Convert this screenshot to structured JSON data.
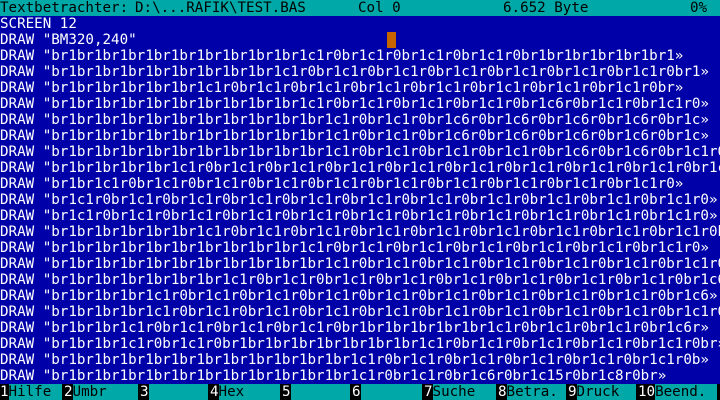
{
  "status": {
    "app_title": "Textbetrachter:",
    "file_path": "D:\\...RAFIK\\TEST.BAS",
    "column": "Col 0",
    "size": "6.652 Byte",
    "percent": "0%"
  },
  "lines": [
    "SCREEN 12",
    "DRAW \"BM320,240\"",
    "DRAW \"br1br1br1br1br1br1br1br1br1br1c1r0br1c1r0br1c1r0br1c1r0br1br1br1br1br1br1»",
    "DRAW \"br1br1br1br1br1br1br1br1br1c1r0br1c1r0br1c1r0br1c1r0br1c1r0br1c1r0br1c1r0br1»",
    "DRAW \"br1br1br1br1br1br1c1r0br1c1r0br1c1r0br1c1r0br1c1r0br1c1r0br1c1r0br1c1r0br»",
    "DRAW \"br1br1br1br1br1br1br1br1br1br1c1r0br1c1r0br1c1r0br1c1r0br1c6r0br1c1r0br1c1r0»",
    "DRAW \"br1br1br1br1br1br1br1br1br1br1br1c1r0br1c1r0br1c6r0br1c6r0br1c6r0br1c6r0br1c»",
    "DRAW \"br1br1br1br1br1br1br1br1br1br1br1c1r0br1c1r0br1c6r0br1c6r0br1c6r0br1c6r0br1c»",
    "DRAW \"br1br1br1br1br1br1br1br1br1br1br1c1r0br1c1r0br1c1r0br1c1r0br1c6r0br1c6r0br1c1r0»",
    "DRAW \"br1br1br1br1br1c1r0br1c1r0br1c1r0br1c1r0br1c1r0br1c1r0br1c1r0br1c1r0br1c1r0br1c1»",
    "DRAW \"br1br1c1r0br1c1r0br1c1r0br1c1r0br1c1r0br1c1r0br1c1r0br1c1r0br1c1r0br1c1r0»",
    "DRAW \"br1c1r0br1c1r0br1c1r0br1c1r0br1c1r0br1c1r0br1c1r0br1c1r0br1c1r0br1c1r0br1c1r0»",
    "DRAW \"br1c1r0br1c1r0br1c1r0br1c1r0br1c1r0br1c1r0br1c1r0br1c1r0br1c1r0br1c1r0br1c1r0»",
    "DRAW \"br1br1br1br1br1br1c1r0br1c1r0br1c1r0br1c1r0br1c1r0br1c1r0br1c1r0br1c1r0br1c1r0br»",
    "DRAW \"br1br1br1br1br1br1br1br1br1br1c1r0br1c1r0br1c1r0br1c1r0br1c1r0br1c1r0br1c1r0»",
    "DRAW \"br1br1br1br1br1br1br1br1br1br1br1c1r0br1c1r0br1c1r0br1c1r0br1c1r0br1c1r0br1c1r0»",
    "DRAW \"br1br1br1br1br1br1br1c1r0br1c1r0br1c1r0br1c1r0br1c1r0br1c1r0br1c1r0br1c1r0br1c6r»",
    "DRAW \"br1br1br1br1c1r0br1c1r0br1c1r0br1c1r0br1c1r0br1c1r0br1c1r0br1c1r0br1c1r0br1c6»",
    "DRAW \"br1br1br1br1c1r0br1c1r0br1c1r0br1c1r0br1c1r0br1c1r0br1c1r0br1c1r0br1c1r0br1c1r0br»",
    "DRAW \"br1br1br1c1r0br1c1r0br1c1r0br1c1r0br1br1br1br1br1br1c1r0br1c1r0br1c1r0br1c6r»",
    "DRAW \"br1br1br1c1r0br1c1r0br1br1br1br1br1br1br1br1c1r0br1c1r0br1c1r0br1c1r0br1c1r0br»",
    "DRAW \"br1br1br1br1br1br1br1br1br1br1br1br1c1r0br1c1r0br1c1r0br1c1r0br1c1r0br1c1r0b»",
    "DRAW \"br1br1br1br1br1br1br1br1br1br1br1br1c1r0br1c1r0br1c6r0br1c15r0br1c8r0br»"
  ],
  "fkeys": [
    {
      "num": "1",
      "label": "Hilfe "
    },
    {
      "num": "2",
      "label": "Umbr  "
    },
    {
      "num": "3",
      "label": "      "
    },
    {
      "num": "4",
      "label": "Hex   "
    },
    {
      "num": "5",
      "label": "      "
    },
    {
      "num": "6",
      "label": "      "
    },
    {
      "num": "7",
      "label": "Suche "
    },
    {
      "num": "8",
      "label": "Betra."
    },
    {
      "num": "9",
      "label": "Druck "
    },
    {
      "num": "10",
      "label": "Beend."
    }
  ],
  "colors": {
    "background": "#0000a8",
    "bar": "#00a8a8",
    "cursor": "#c86400"
  }
}
